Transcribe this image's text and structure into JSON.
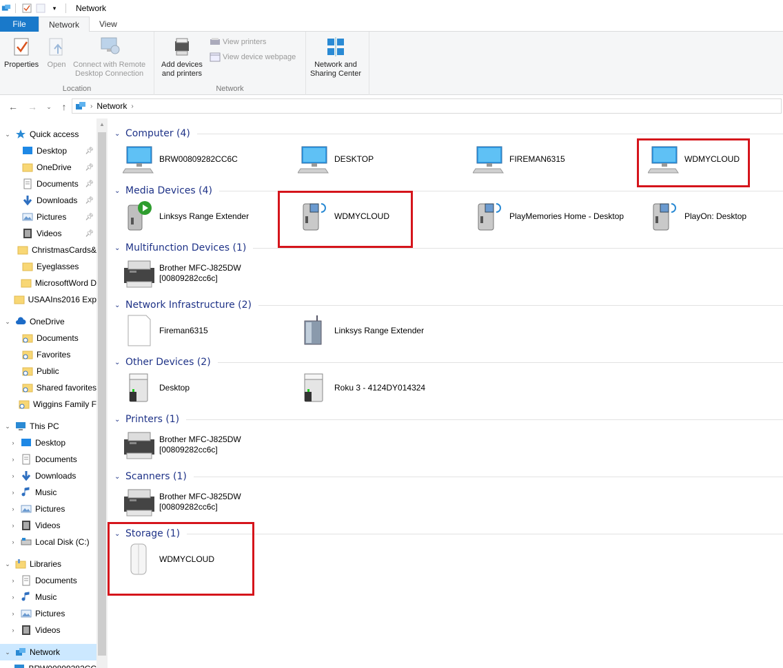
{
  "window": {
    "title": "Network"
  },
  "tabs": [
    {
      "label": "File"
    },
    {
      "label": "Network"
    },
    {
      "label": "View"
    }
  ],
  "ribbon": {
    "location_group": {
      "label": "Location",
      "properties": "Properties",
      "open": "Open",
      "connect_remote_1": "Connect with Remote",
      "connect_remote_2": "Desktop Connection"
    },
    "network_group": {
      "label": "Network",
      "add_devices_1": "Add devices",
      "add_devices_2": "and printers",
      "view_printers": "View printers",
      "view_webpage": "View device webpage"
    },
    "sharing_group": {
      "nsc_1": "Network and",
      "nsc_2": "Sharing Center"
    }
  },
  "address": {
    "crumb": "Network"
  },
  "sidebar": {
    "items": [
      {
        "label": "Quick access",
        "icon": "star-icon"
      },
      {
        "label": "Desktop",
        "icon": "desktop-icon",
        "pinned": true
      },
      {
        "label": "OneDrive",
        "icon": "folder-icon",
        "pinned": true
      },
      {
        "label": "Documents",
        "icon": "documents-icon",
        "pinned": true
      },
      {
        "label": "Downloads",
        "icon": "download-icon",
        "pinned": true
      },
      {
        "label": "Pictures",
        "icon": "pictures-icon",
        "pinned": true
      },
      {
        "label": "Videos",
        "icon": "videos-icon",
        "pinned": true
      },
      {
        "label": "ChristmasCards&",
        "icon": "folder-icon"
      },
      {
        "label": "Eyeglasses",
        "icon": "folder-icon"
      },
      {
        "label": "MicrosoftWord D",
        "icon": "folder-icon"
      },
      {
        "label": "USAAIns2016 Exp",
        "icon": "folder-icon"
      },
      {
        "label": "OneDrive",
        "icon": "cloud-icon"
      },
      {
        "label": "Documents",
        "icon": "sync-folder-icon"
      },
      {
        "label": "Favorites",
        "icon": "sync-folder-icon"
      },
      {
        "label": "Public",
        "icon": "sync-folder-icon"
      },
      {
        "label": "Shared favorites",
        "icon": "sync-folder-icon"
      },
      {
        "label": "Wiggins Family F",
        "icon": "sync-folder-icon"
      },
      {
        "label": "This PC",
        "icon": "computer-icon"
      },
      {
        "label": "Desktop",
        "icon": "desktop-icon"
      },
      {
        "label": "Documents",
        "icon": "documents-icon"
      },
      {
        "label": "Downloads",
        "icon": "download-icon"
      },
      {
        "label": "Music",
        "icon": "music-icon"
      },
      {
        "label": "Pictures",
        "icon": "pictures-icon"
      },
      {
        "label": "Videos",
        "icon": "videos-icon"
      },
      {
        "label": "Local Disk (C:)",
        "icon": "disk-icon"
      },
      {
        "label": "Libraries",
        "icon": "libraries-icon"
      },
      {
        "label": "Documents",
        "icon": "documents-icon"
      },
      {
        "label": "Music",
        "icon": "music-icon"
      },
      {
        "label": "Pictures",
        "icon": "pictures-icon"
      },
      {
        "label": "Videos",
        "icon": "videos-icon"
      },
      {
        "label": "Network",
        "icon": "network-icon"
      },
      {
        "label": "BRW00809282CC",
        "icon": "computer-icon"
      }
    ]
  },
  "groups": [
    {
      "title": "Computer (4)",
      "items": [
        {
          "label": "BRW00809282CC6C",
          "icon": "monitor-icon"
        },
        {
          "label": "DESKTOP",
          "icon": "monitor-icon"
        },
        {
          "label": "FIREMAN6315",
          "icon": "monitor-icon"
        },
        {
          "label": "WDMYCLOUD",
          "icon": "monitor-icon"
        }
      ]
    },
    {
      "title": "Media Devices (4)",
      "items": [
        {
          "label": "Linksys Range Extender",
          "icon": "media-player-icon"
        },
        {
          "label": "WDMYCLOUD",
          "icon": "media-server-icon"
        },
        {
          "label": "PlayMemories Home - Desktop",
          "icon": "media-server-icon"
        },
        {
          "label": "PlayOn: Desktop",
          "icon": "media-server-icon"
        }
      ]
    },
    {
      "title": "Multifunction Devices (1)",
      "items": [
        {
          "label1": "Brother MFC-J825DW",
          "label2": "[00809282cc6c]",
          "icon": "printer-icon"
        }
      ]
    },
    {
      "title": "Network Infrastructure (2)",
      "items": [
        {
          "label": "Fireman6315",
          "icon": "blank-document-icon"
        },
        {
          "label": "Linksys Range Extender",
          "icon": "router-icon"
        }
      ]
    },
    {
      "title": "Other Devices (2)",
      "items": [
        {
          "label": "Desktop",
          "icon": "device-tower-icon"
        },
        {
          "label": "Roku 3 - 4124DY014324",
          "icon": "device-tower-icon"
        }
      ]
    },
    {
      "title": "Printers (1)",
      "items": [
        {
          "label1": "Brother MFC-J825DW",
          "label2": "[00809282cc6c]",
          "icon": "printer-icon"
        }
      ]
    },
    {
      "title": "Scanners (1)",
      "items": [
        {
          "label1": "Brother MFC-J825DW",
          "label2": "[00809282cc6c]",
          "icon": "printer-icon"
        }
      ]
    },
    {
      "title": "Storage (1)",
      "items": [
        {
          "label": "WDMYCLOUD",
          "icon": "storage-drive-icon"
        }
      ]
    }
  ],
  "colors": {
    "highlight": "#d5141b",
    "group_title": "#1e3287",
    "file_tab": "#1979ca",
    "selected": "#cce8ff"
  }
}
